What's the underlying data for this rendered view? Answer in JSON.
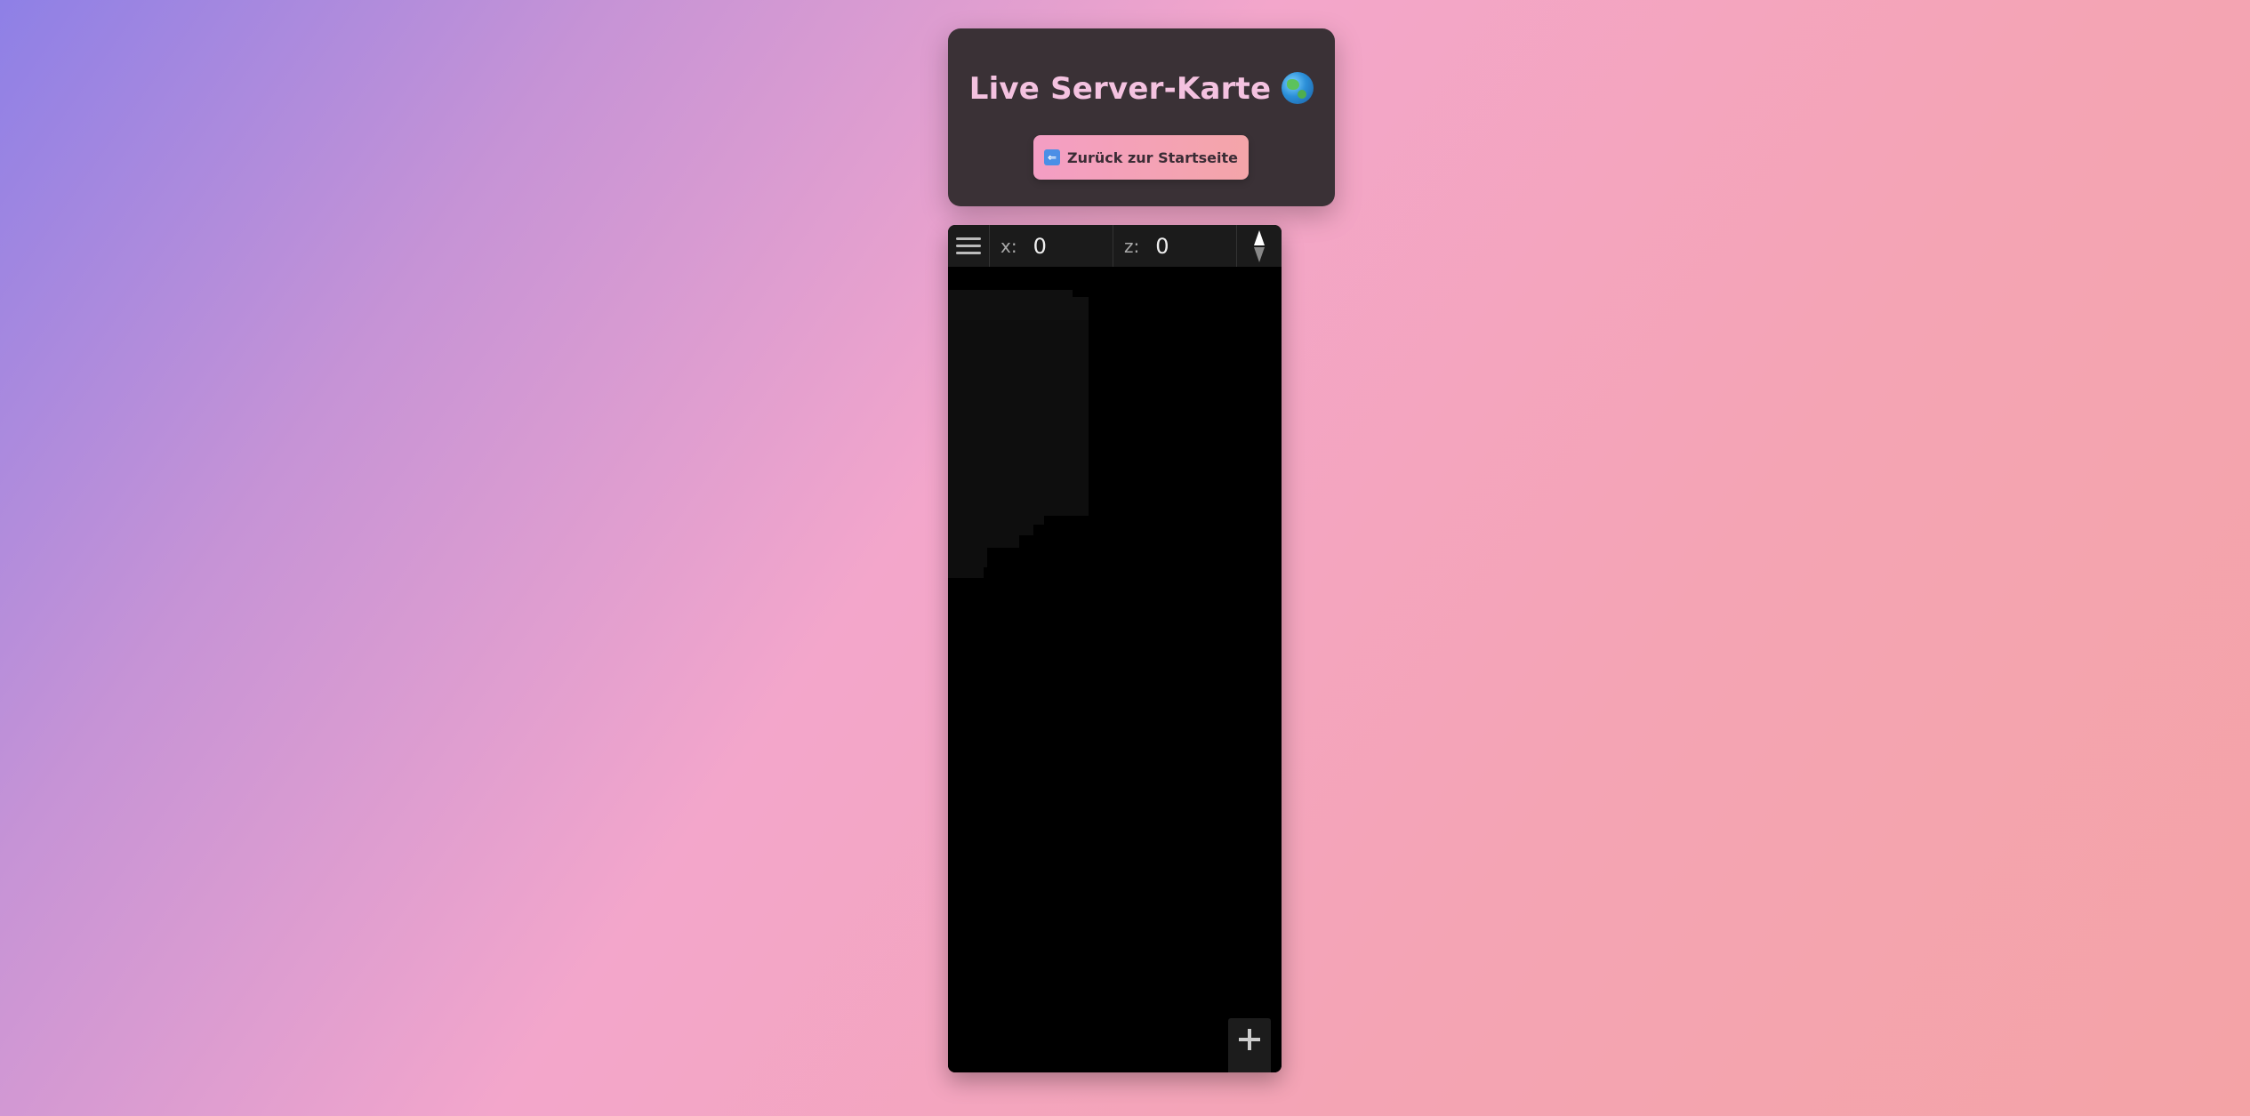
{
  "header": {
    "title": "Live Server-Karte",
    "back_button_label": "Zurück zur Startseite",
    "title_icon": "globe-icon",
    "back_icon": "back-arrow-icon"
  },
  "map": {
    "toolbar": {
      "menu_icon": "hamburger-menu-icon",
      "x_label": "x:",
      "x_value": "0",
      "z_label": "z:",
      "z_value": "0",
      "compass_icon": "compass-icon"
    },
    "zoom": {
      "zoom_in_icon": "plus-icon",
      "zoom_out_icon": "minus-icon"
    }
  },
  "colors": {
    "card_bg": "#3a3136",
    "title_color": "#f4c2e0",
    "button_gradient_start": "#f49ec4",
    "button_gradient_end": "#f4a5a9",
    "map_bg": "#000000",
    "toolbar_bg": "#1b1b1b"
  }
}
